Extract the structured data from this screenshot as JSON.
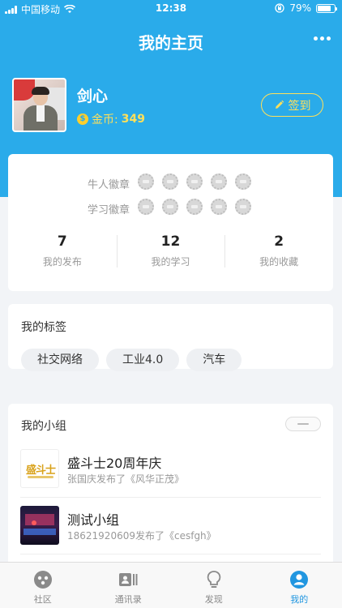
{
  "status_bar": {
    "carrier": "中国移动",
    "time": "12:38",
    "battery": "79%",
    "battery_level": 0.79
  },
  "nav": {
    "title": "我的主页"
  },
  "profile": {
    "name": "剑心",
    "coins_label": "金币:",
    "coins_value": "349",
    "coin_icon_text": "$",
    "signin_label": "签到"
  },
  "badges": [
    {
      "label": "牛人徽章",
      "count": 5
    },
    {
      "label": "学习徽章",
      "count": 5
    }
  ],
  "stats": [
    {
      "num": "7",
      "label": "我的发布"
    },
    {
      "num": "12",
      "label": "我的学习"
    },
    {
      "num": "2",
      "label": "我的收藏"
    }
  ],
  "tags": {
    "title": "我的标签",
    "items": [
      "社交网络",
      "工业4.0",
      "汽车"
    ]
  },
  "groups": {
    "title": "我的小组",
    "items": [
      {
        "name": "盛斗士20周年庆",
        "sub": "张国庆发布了《风华正茂》",
        "thumb_text": "盛斗士"
      },
      {
        "name": "测试小组",
        "sub": "18621920609发布了《cesfgh》"
      }
    ]
  },
  "tabbar": [
    {
      "label": "社区",
      "icon": "community-icon",
      "active": false
    },
    {
      "label": "通讯录",
      "icon": "contacts-icon",
      "active": false
    },
    {
      "label": "发现",
      "icon": "bulb-icon",
      "active": false
    },
    {
      "label": "我的",
      "icon": "user-icon",
      "active": true
    }
  ],
  "colors": {
    "primary": "#2aabea",
    "accent": "#ffe05a",
    "tab_active": "#2196e0"
  }
}
